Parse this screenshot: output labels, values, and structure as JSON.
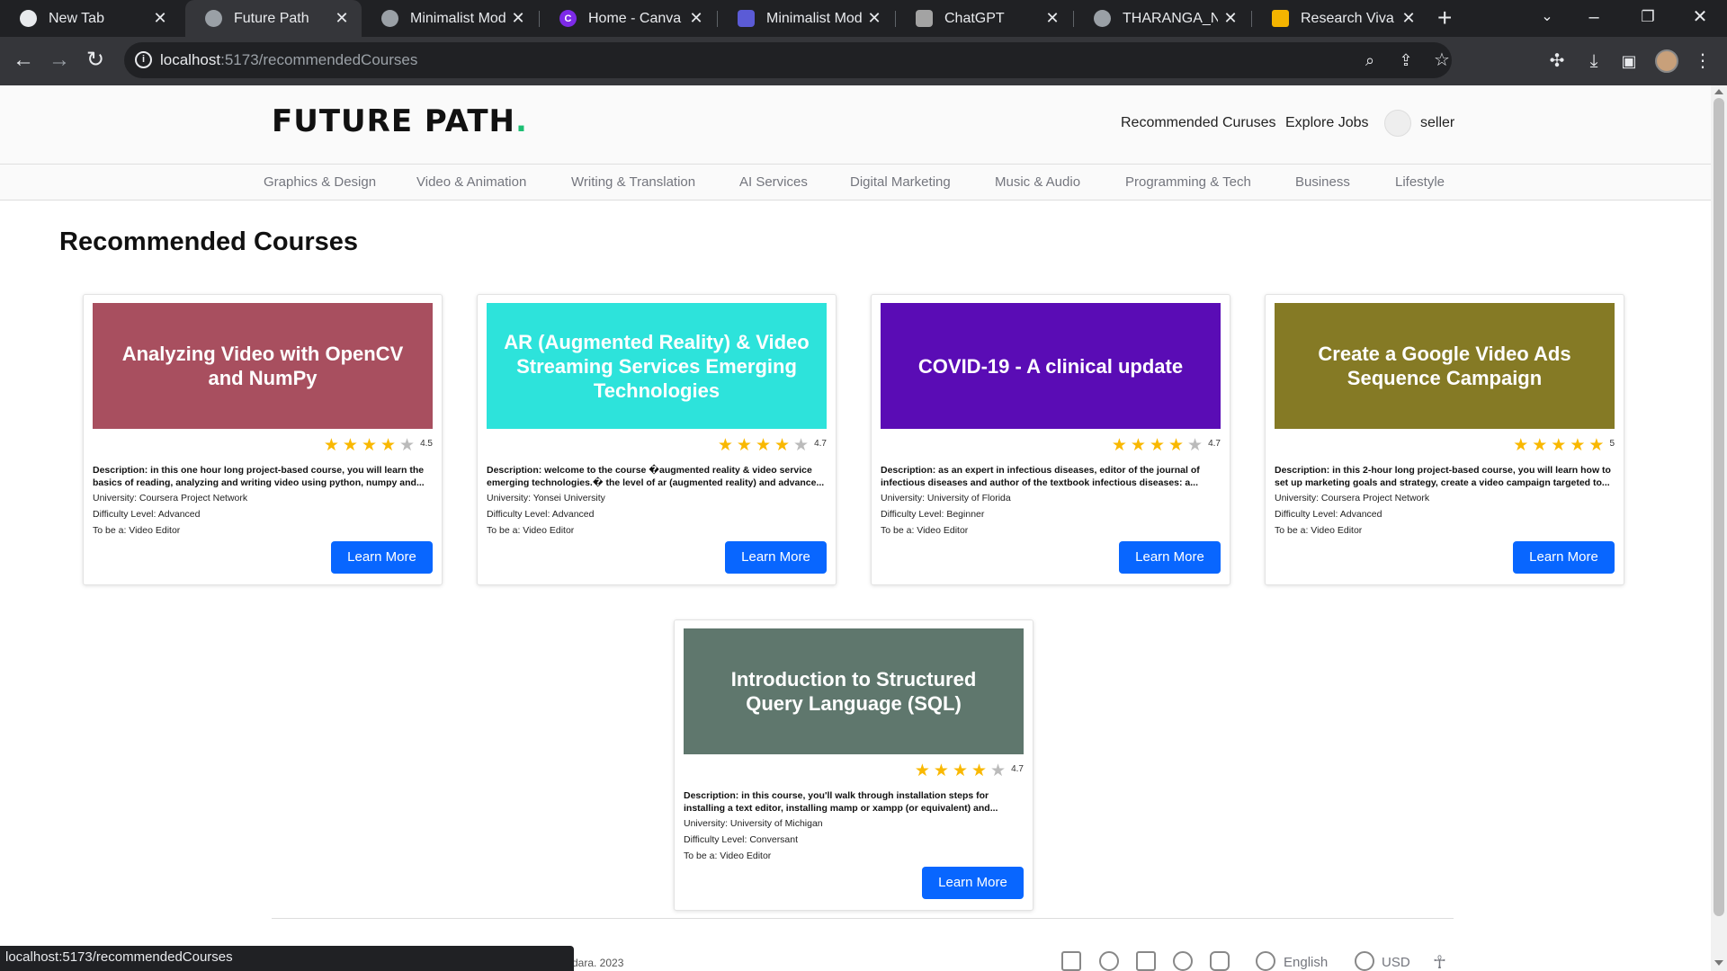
{
  "browser": {
    "tabs": [
      {
        "title": "New Tab",
        "favicon_color": "#e8eaed",
        "active": false
      },
      {
        "title": "Future Path",
        "favicon_color": "#9aa0a6",
        "active": true
      },
      {
        "title": "Minimalist Mode",
        "favicon_color": "#9aa0a6",
        "active": false
      },
      {
        "title": "Home - Canva",
        "favicon_color": "#7d2ae8",
        "active": false
      },
      {
        "title": "Minimalist Mode",
        "favicon_color": "#5b5bd6",
        "active": false
      },
      {
        "title": "ChatGPT",
        "favicon_color": "#a3a3a3",
        "active": false
      },
      {
        "title": "THARANGA_NUW",
        "favicon_color": "#9aa0a6",
        "active": false
      },
      {
        "title": "Research Viva - G",
        "favicon_color": "#f4b400",
        "active": false
      }
    ],
    "url_host": "localhost",
    "url_path": ":5173/recommendedCourses",
    "status_url": "localhost:5173/recommendedCourses"
  },
  "header": {
    "logo_text": "FUTURE PATH",
    "logo_dot": ".",
    "nav": [
      "Recommended Curuses",
      "Explore Jobs"
    ],
    "username": "seller"
  },
  "categories": [
    "Graphics & Design",
    "Video & Animation",
    "Writing & Translation",
    "AI Services",
    "Digital Marketing",
    "Music & Audio",
    "Programming & Tech",
    "Business",
    "Lifestyle"
  ],
  "section_title": "Recommended Courses",
  "courses": [
    {
      "title": "Analyzing Video with OpenCV and NumPy",
      "banner_color": "#a84f5f",
      "rating": 4.5,
      "rating_label": "4.5",
      "description": "Description: in this one hour long project-based course, you will learn the basics of reading, analyzing and writing video using python, numpy and...",
      "university": "University: Coursera Project Network",
      "difficulty": "Difficulty Level: Advanced",
      "to_be": "To be a: Video Editor",
      "button": "Learn More"
    },
    {
      "title": "AR (Augmented Reality) & Video Streaming Services Emerging Technologies",
      "banner_color": "#2de3db",
      "rating": 4.7,
      "rating_label": "4.7",
      "description": "Description: welcome to the course �augmented reality & video service emerging technologies.� the level of ar (augmented reality) and advance...",
      "university": "University: Yonsei University",
      "difficulty": "Difficulty Level: Advanced",
      "to_be": "To be a: Video Editor",
      "button": "Learn More"
    },
    {
      "title": "COVID-19 - A clinical update",
      "banner_color": "#5a0cb5",
      "rating": 4.7,
      "rating_label": "4.7",
      "description": "Description: as an expert in infectious diseases, editor of the journal of infectious diseases and author of the textbook infectious diseases: a...",
      "university": "University: University of Florida",
      "difficulty": "Difficulty Level: Beginner",
      "to_be": "To be a: Video Editor",
      "button": "Learn More"
    },
    {
      "title": "Create a Google Video Ads Sequence Campaign",
      "banner_color": "#857a25",
      "rating": 5,
      "rating_label": "5",
      "description": "Description: in this 2-hour long project-based course, you will learn how to set up marketing goals and strategy, create a video campaign targeted to...",
      "university": "University: Coursera Project Network",
      "difficulty": "Difficulty Level: Advanced",
      "to_be": "To be a: Video Editor",
      "button": "Learn More"
    },
    {
      "title": "Introduction to Structured Query Language (SQL)",
      "banner_color": "#5f776d",
      "rating": 4.7,
      "rating_label": "4.7",
      "description": "Description: in this course, you'll walk through installation steps for installing a text editor, installing mamp or xampp (or equivalent) and...",
      "university": "University: University of Michigan",
      "difficulty": "Difficulty Level: Conversant",
      "to_be": "To be a: Video Editor",
      "button": "Learn More"
    }
  ],
  "footer": {
    "copyright": "dara. 2023",
    "social_icons": [
      "twitter-icon",
      "facebook-icon",
      "linkedin-icon",
      "pinterest-icon",
      "instagram-icon"
    ],
    "language": "English",
    "currency": "USD"
  },
  "colors": {
    "accent": "#0866ff",
    "star": "#f9b800",
    "logo_dot": "#1dbf73"
  }
}
